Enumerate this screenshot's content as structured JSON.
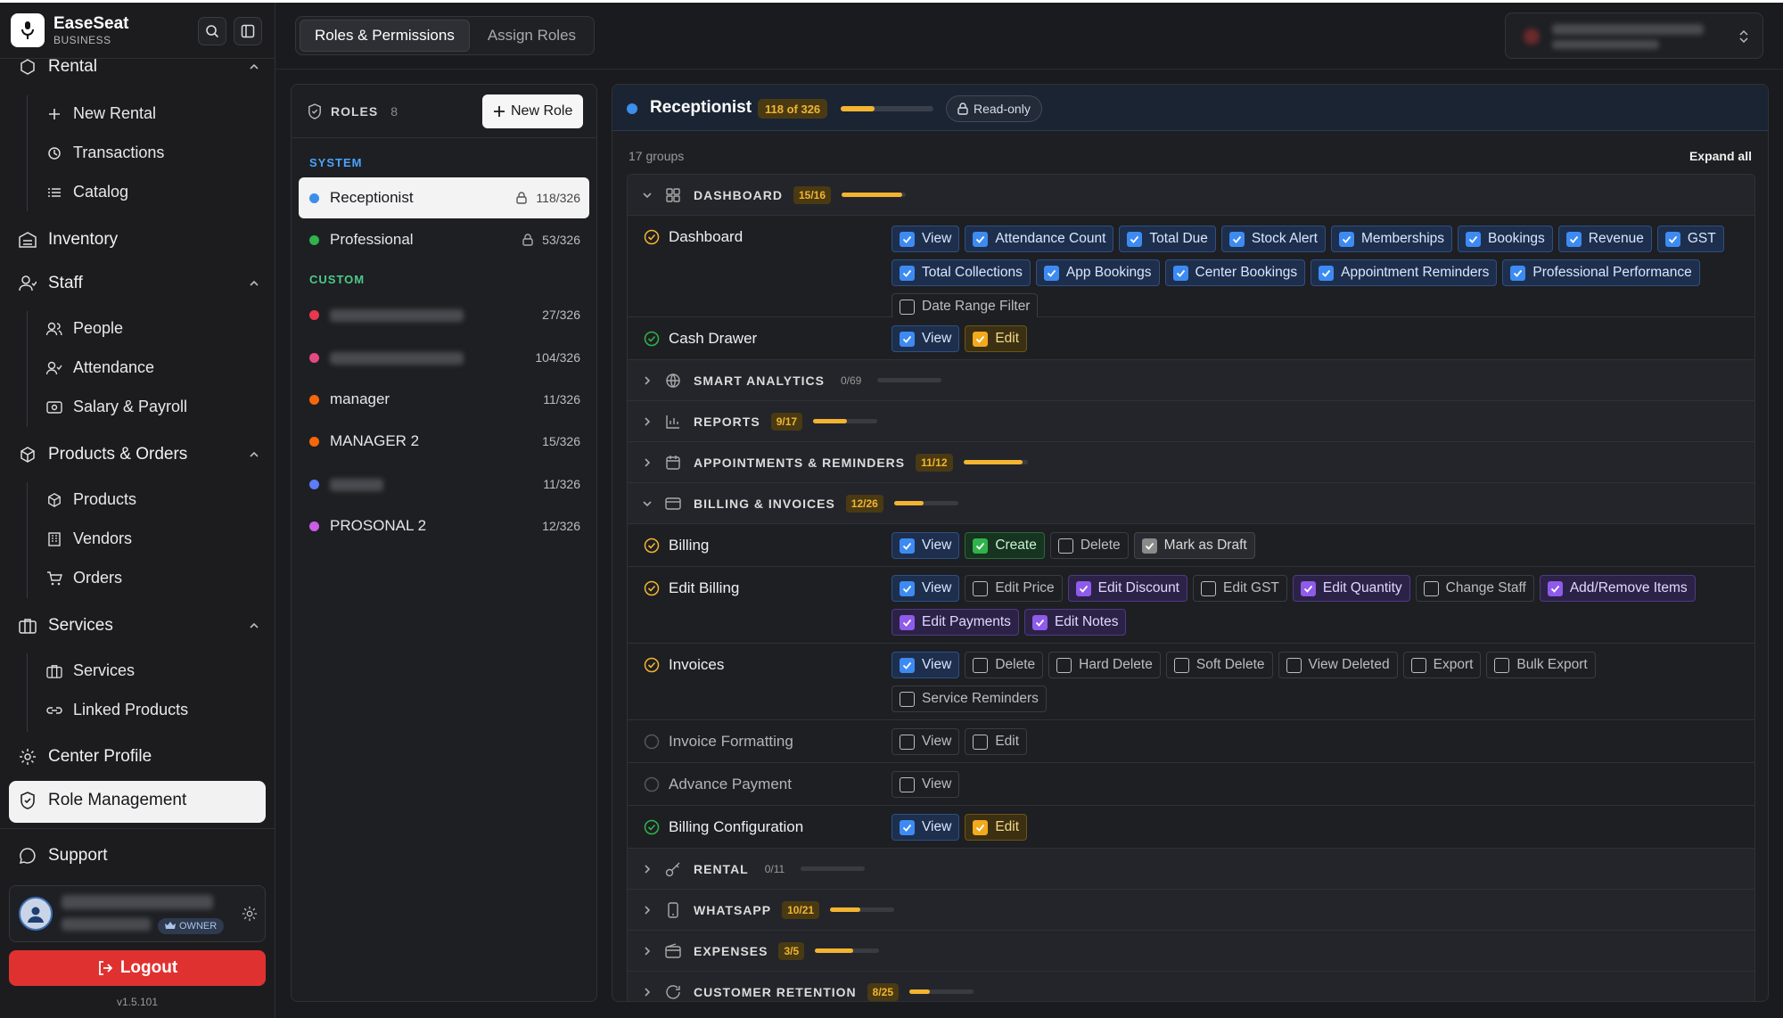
{
  "app": {
    "name": "EaseSeat",
    "plan": "BUSINESS",
    "version": "v1.5.101"
  },
  "sidebar": {
    "rental_label": "Rental",
    "rental_items": [
      "New Rental",
      "Transactions",
      "Catalog"
    ],
    "inventory_label": "Inventory",
    "staff_label": "Staff",
    "staff_items": [
      "People",
      "Attendance",
      "Salary & Payroll"
    ],
    "products_label": "Products & Orders",
    "products_items": [
      "Products",
      "Vendors",
      "Orders"
    ],
    "services_label": "Services",
    "services_items": [
      "Services",
      "Linked Products"
    ],
    "center_profile_label": "Center Profile",
    "role_management_label": "Role Management",
    "support_label": "Support",
    "user_role_badge": "OWNER",
    "logout_label": "Logout"
  },
  "top_tabs": [
    "Roles & Permissions",
    "Assign Roles"
  ],
  "roles": {
    "title": "ROLES",
    "count": "8",
    "new_role_label": "New Role",
    "system_label": "SYSTEM",
    "custom_label": "CUSTOM",
    "system": [
      {
        "name": "Receptionist",
        "count": "118/326",
        "color": "#3b8eea"
      },
      {
        "name": "Professional",
        "count": "53/326",
        "color": "#2fb34a"
      }
    ],
    "custom": [
      {
        "name": "",
        "count": "27/326",
        "color": "#e8384f"
      },
      {
        "name": "",
        "count": "104/326",
        "color": "#e64980"
      },
      {
        "name": "manager",
        "count": "11/326",
        "color": "#f76707"
      },
      {
        "name": "MANAGER 2",
        "count": "15/326",
        "color": "#f76707"
      },
      {
        "name": "",
        "count": "11/326",
        "color": "#5c7cfa"
      },
      {
        "name": "PROSONAL 2",
        "count": "12/326",
        "color": "#cc5de8"
      }
    ]
  },
  "perm": {
    "role_name": "Receptionist",
    "role_summary": "118 of 326",
    "role_progress": 0.362,
    "readonly_label": "Read-only",
    "groups_count_label": "17 groups",
    "expand_all_label": "Expand all",
    "groups": [
      {
        "name": "DASHBOARD",
        "badge": "15/16",
        "progress": 0.9375,
        "icon": "grid-icon",
        "expanded": true
      },
      {
        "name": "SMART ANALYTICS",
        "badge": "0/69",
        "progress": 0,
        "icon": "globe-icon",
        "expanded": false
      },
      {
        "name": "REPORTS",
        "badge": "9/17",
        "progress": 0.53,
        "icon": "bar-chart-icon",
        "expanded": false
      },
      {
        "name": "APPOINTMENTS & REMINDERS",
        "badge": "11/12",
        "progress": 0.917,
        "icon": "calendar-icon",
        "expanded": false
      },
      {
        "name": "BILLING & INVOICES",
        "badge": "12/26",
        "progress": 0.46,
        "icon": "card-icon",
        "expanded": true
      },
      {
        "name": "RENTAL",
        "badge": "0/11",
        "progress": 0,
        "icon": "key-icon",
        "expanded": false
      },
      {
        "name": "WHATSAPP",
        "badge": "10/21",
        "progress": 0.476,
        "icon": "phone-icon",
        "expanded": false
      },
      {
        "name": "EXPENSES",
        "badge": "3/5",
        "progress": 0.6,
        "icon": "wallet-icon",
        "expanded": false
      },
      {
        "name": "CUSTOMER RETENTION",
        "badge": "8/25",
        "progress": 0.32,
        "icon": "refresh-icon",
        "expanded": false
      }
    ],
    "rows": {
      "dashboard": {
        "label": "Dashboard",
        "chips": [
          {
            "label": "View",
            "state": "blue"
          },
          {
            "label": "Attendance Count",
            "state": "blue"
          },
          {
            "label": "Total Due",
            "state": "blue"
          },
          {
            "label": "Stock Alert",
            "state": "blue"
          },
          {
            "label": "Memberships",
            "state": "blue"
          },
          {
            "label": "Bookings",
            "state": "blue"
          },
          {
            "label": "Revenue",
            "state": "blue"
          },
          {
            "label": "GST",
            "state": "blue"
          },
          {
            "label": "Total Collections",
            "state": "blue"
          },
          {
            "label": "App Bookings",
            "state": "blue"
          },
          {
            "label": "Center Bookings",
            "state": "blue"
          },
          {
            "label": "Appointment Reminders",
            "state": "blue"
          },
          {
            "label": "Professional Performance",
            "state": "blue"
          },
          {
            "label": "Date Range Filter",
            "state": "off"
          }
        ]
      },
      "cash_drawer": {
        "label": "Cash Drawer",
        "chips": [
          {
            "label": "View",
            "state": "blue"
          },
          {
            "label": "Edit",
            "state": "amber"
          }
        ]
      },
      "billing": {
        "label": "Billing",
        "chips": [
          {
            "label": "View",
            "state": "blue"
          },
          {
            "label": "Create",
            "state": "green"
          },
          {
            "label": "Delete",
            "state": "off"
          },
          {
            "label": "Mark as Draft",
            "state": "gray"
          }
        ]
      },
      "edit_billing": {
        "label": "Edit Billing",
        "chips": [
          {
            "label": "View",
            "state": "blue"
          },
          {
            "label": "Edit Price",
            "state": "off"
          },
          {
            "label": "Edit Discount",
            "state": "purple"
          },
          {
            "label": "Edit GST",
            "state": "off"
          },
          {
            "label": "Edit Quantity",
            "state": "purple"
          },
          {
            "label": "Change Staff",
            "state": "off"
          },
          {
            "label": "Add/Remove Items",
            "state": "purple"
          },
          {
            "label": "Edit Payments",
            "state": "purple"
          },
          {
            "label": "Edit Notes",
            "state": "purple"
          }
        ]
      },
      "invoices": {
        "label": "Invoices",
        "chips": [
          {
            "label": "View",
            "state": "blue"
          },
          {
            "label": "Delete",
            "state": "off"
          },
          {
            "label": "Hard Delete",
            "state": "off"
          },
          {
            "label": "Soft Delete",
            "state": "off"
          },
          {
            "label": "View Deleted",
            "state": "off"
          },
          {
            "label": "Export",
            "state": "off"
          },
          {
            "label": "Bulk Export",
            "state": "off"
          },
          {
            "label": "Service Reminders",
            "state": "off"
          }
        ]
      },
      "invoice_formatting": {
        "label": "Invoice Formatting",
        "chips": [
          {
            "label": "View",
            "state": "off"
          },
          {
            "label": "Edit",
            "state": "off"
          }
        ]
      },
      "advance_payment": {
        "label": "Advance Payment",
        "chips": [
          {
            "label": "View",
            "state": "off"
          }
        ]
      },
      "billing_configuration": {
        "label": "Billing Configuration",
        "chips": [
          {
            "label": "View",
            "state": "blue"
          },
          {
            "label": "Edit",
            "state": "amber"
          }
        ]
      }
    }
  },
  "colors": {
    "accent_amber": "#f2b431",
    "accent_blue": "#3b8eea",
    "logout_red": "#e03131"
  }
}
